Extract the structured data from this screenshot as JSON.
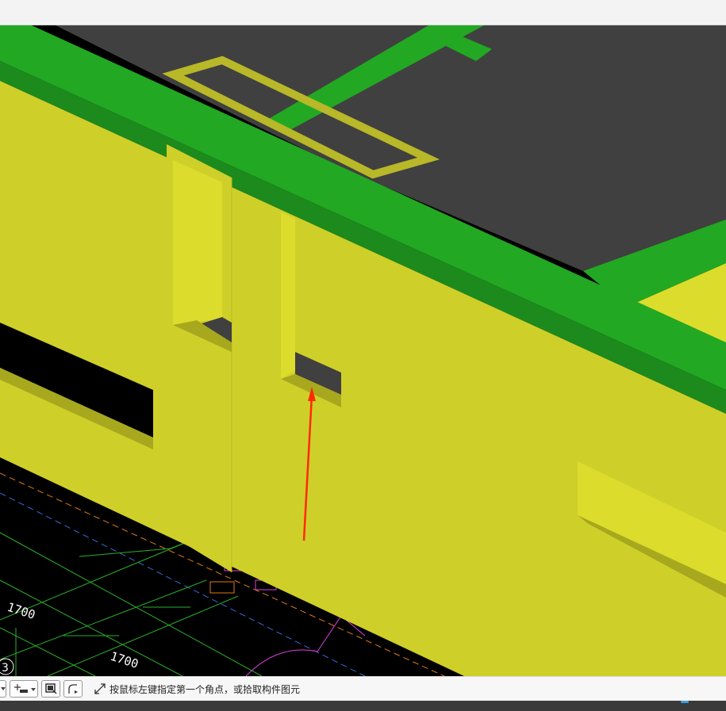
{
  "viewport": {
    "dimensions": [
      "1700",
      "1700"
    ],
    "axis_label": "3"
  },
  "statusbar": {
    "prompt": "按鼠标左键指定第一个角点，或拾取构件图元",
    "icons": [
      "dropdown-icon",
      "point-add-icon",
      "view-select-icon",
      "polyline-icon",
      "expand-icon"
    ]
  },
  "colors": {
    "wall_face": "#cfcf2a",
    "wall_face_light": "#dcdc2c",
    "beam_green": "#22a822",
    "slab_gray": "#404040",
    "arrow": "#ff2a00"
  }
}
